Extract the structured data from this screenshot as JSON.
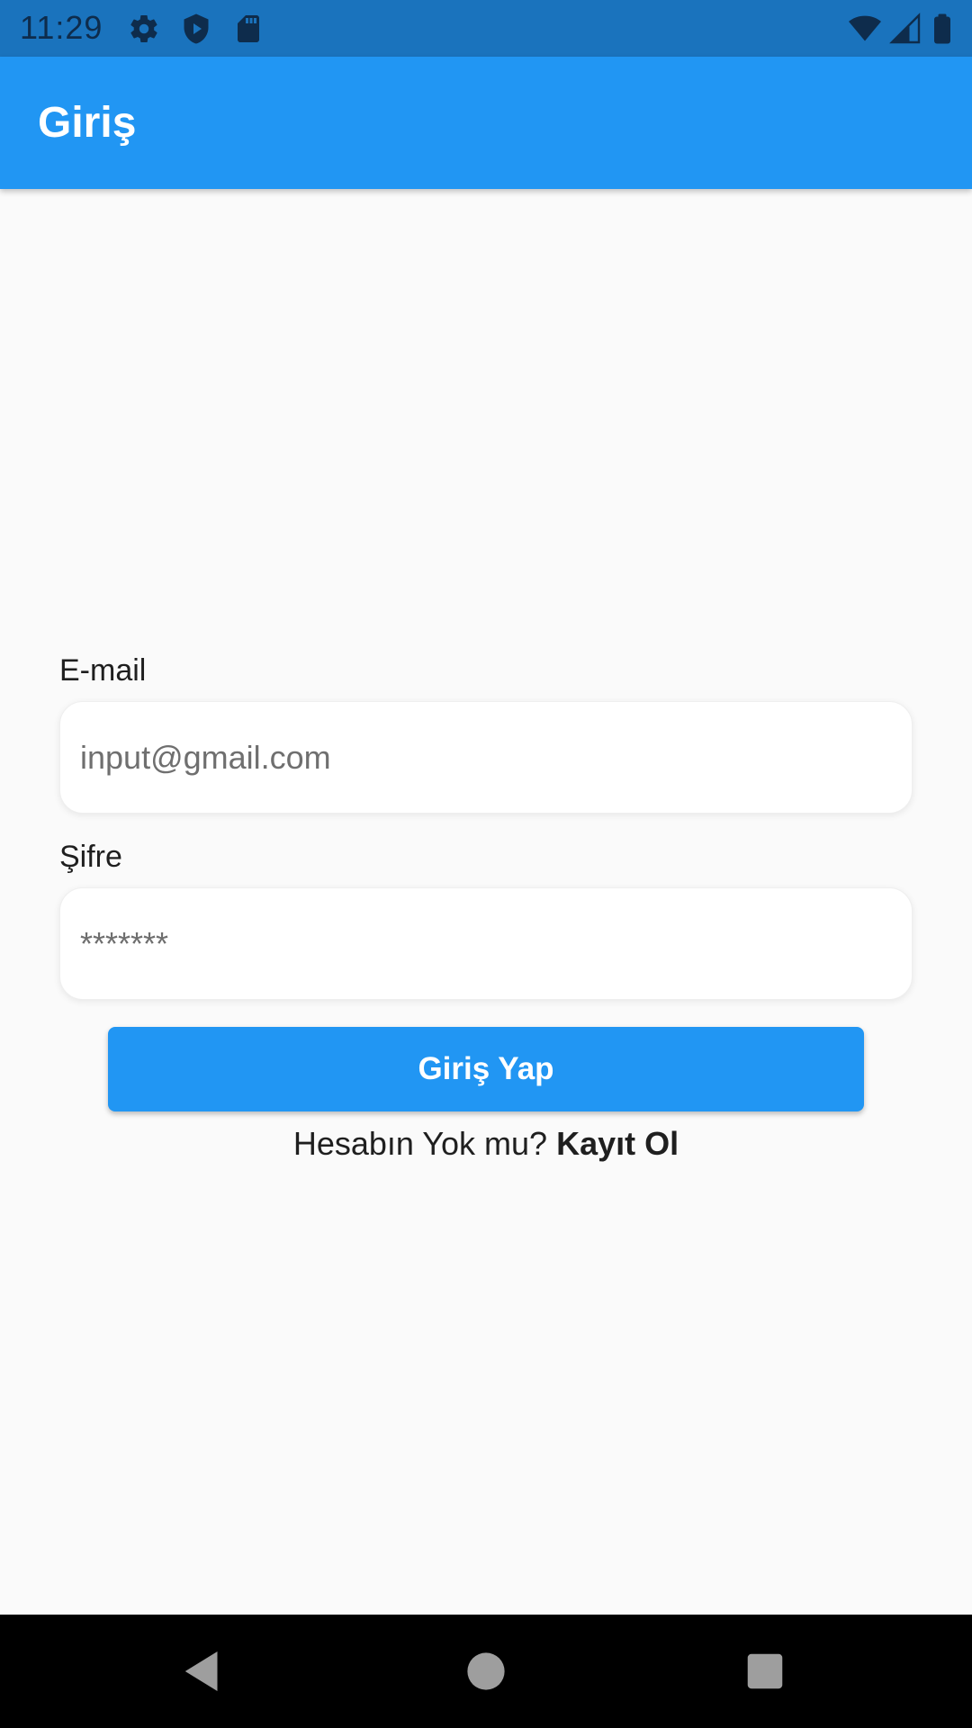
{
  "status_bar": {
    "time": "11:29",
    "left_icons": [
      "gear-icon",
      "shield-play-icon",
      "sd-card-icon"
    ],
    "right_icons": [
      "wifi-icon",
      "cell-signal-icon",
      "battery-icon"
    ]
  },
  "app_bar": {
    "title": "Giriş",
    "color": "#2196f3"
  },
  "form": {
    "email": {
      "label": "E-mail",
      "placeholder": "input@gmail.com"
    },
    "password": {
      "label": "Şifre",
      "placeholder": "*******"
    },
    "submit_label": "Giriş Yap",
    "register_prompt": "Hesabın Yok mu?",
    "register_link": "Kayıt Ol"
  },
  "nav_bar": {
    "buttons": [
      "back-icon",
      "home-icon",
      "recents-icon"
    ]
  }
}
